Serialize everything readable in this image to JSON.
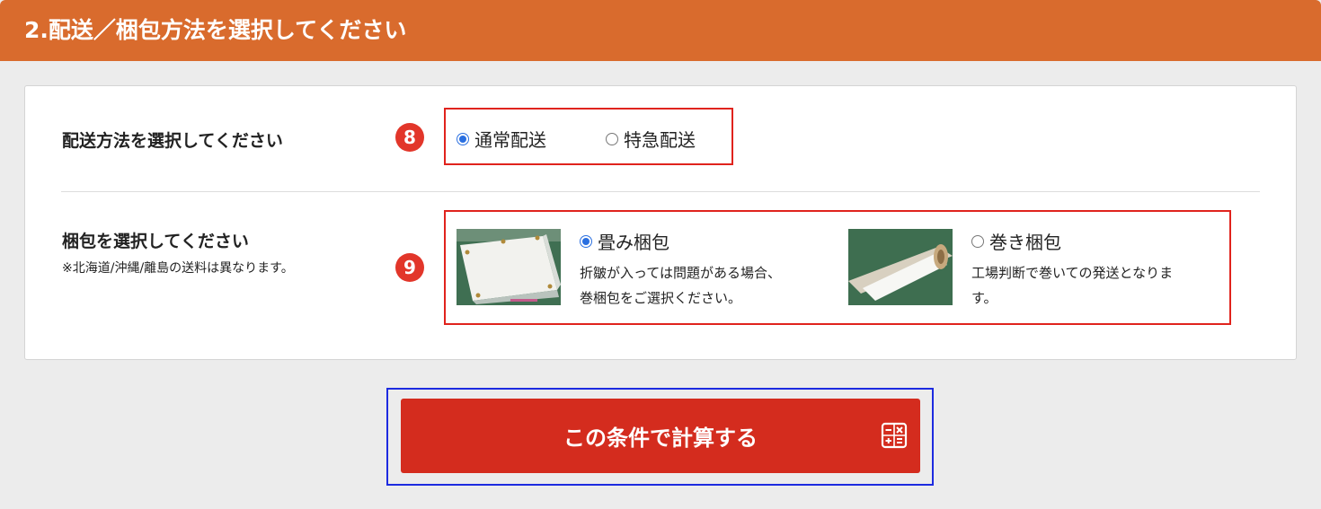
{
  "header": {
    "title": "2.配送／梱包方法を選択してください"
  },
  "shipping": {
    "label": "配送方法を選択してください",
    "step": "8",
    "options": [
      {
        "label": "通常配送",
        "selected": true
      },
      {
        "label": "特急配送",
        "selected": false
      }
    ]
  },
  "packing": {
    "label": "梱包を選択してください",
    "note": "※北海道/沖縄/離島の送料は異なります。",
    "step": "9",
    "options": [
      {
        "label": "畳み梱包",
        "selected": true,
        "desc_line1": "折皺が入っては問題がある場合、",
        "desc_line2": "巻梱包をご選択ください。",
        "image": "folded-sheet-photo"
      },
      {
        "label": "巻き梱包",
        "selected": false,
        "desc_line1": "工場判断で巻いての発送となりま",
        "desc_line2": "す。",
        "image": "rolled-sheet-photo"
      }
    ]
  },
  "calculate": {
    "label": "この条件で計算する",
    "icon": "calculator-icon"
  },
  "colors": {
    "header_bg": "#d96b2d",
    "badge": "#e2362a",
    "highlight_box": "#e0231d",
    "button_bg": "#d42c1e",
    "button_outline": "#1d2be0",
    "radio_checked": "#2a6fe0"
  }
}
